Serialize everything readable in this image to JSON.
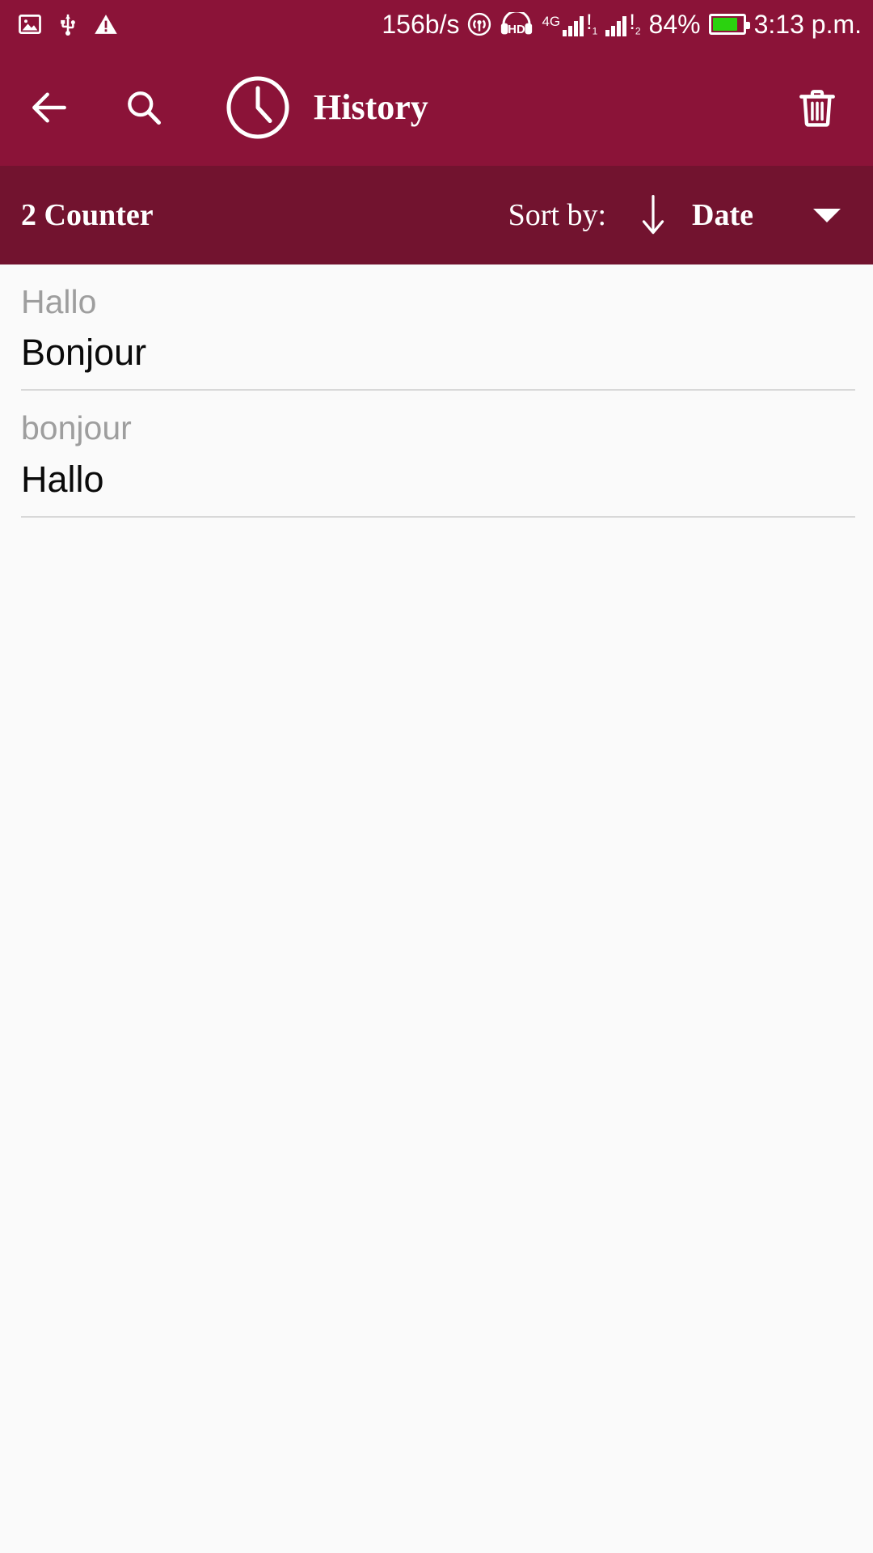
{
  "status_bar": {
    "left_icons": [
      "image-icon",
      "usb-icon",
      "warning-icon"
    ],
    "data_speed": "156b/s",
    "hotspot_icon": "hotspot-icon",
    "hd_label": "HD",
    "network_type": "4G",
    "sim1_bang": "!",
    "sim1_index": "1",
    "sim2_bang": "!",
    "sim2_index": "2",
    "battery_percent": "84%",
    "battery_level": 84,
    "battery_color": "#2BD20F",
    "time": "3:13 p.m."
  },
  "app_bar": {
    "back_icon": "back-arrow-icon",
    "search_icon": "search-icon",
    "history_icon": "clock-icon",
    "title": "History",
    "delete_icon": "trash-icon",
    "background_color": "#8B1338"
  },
  "sort_bar": {
    "counter_text": "2 Counter",
    "sort_by_label": "Sort by:",
    "sort_direction_icon": "arrow-down-icon",
    "sort_value": "Date",
    "dropdown_icon": "caret-down-icon",
    "background_color": "#72132F"
  },
  "history": {
    "items": [
      {
        "source": "Hallo",
        "target": "Bonjour"
      },
      {
        "source": "bonjour",
        "target": "Hallo"
      }
    ]
  },
  "colors": {
    "primary": "#8B1338",
    "primary_dark": "#72132F",
    "body_background": "#FAFAFA",
    "source_text": "#9E9E9E",
    "target_text": "#0A0A0A",
    "divider": "#D8D8D8"
  }
}
